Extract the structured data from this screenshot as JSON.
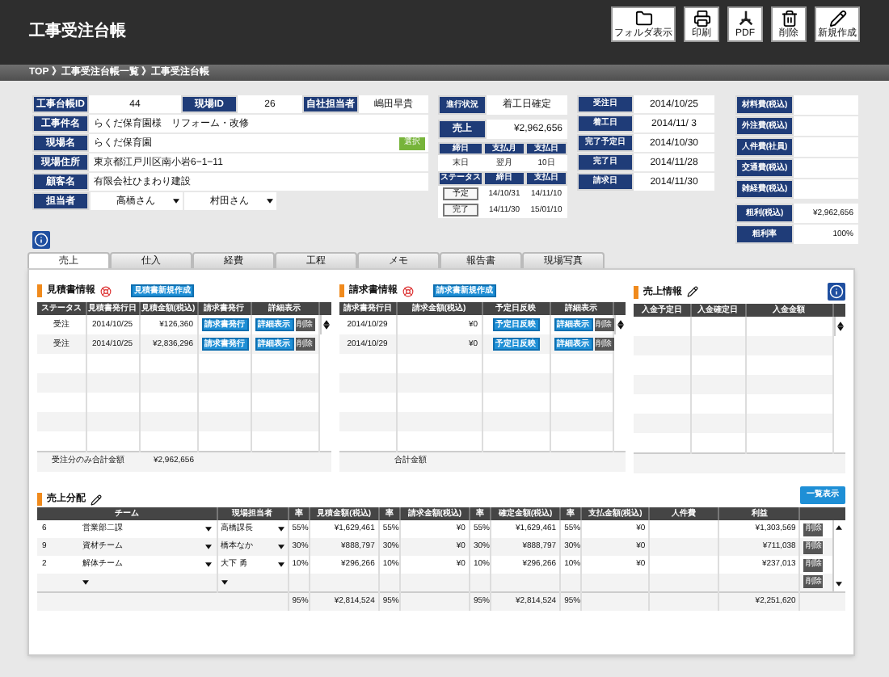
{
  "header": {
    "title": "工事受注台帳",
    "toolbar": [
      {
        "kind": "folder",
        "label": "フォルダ表示"
      },
      {
        "kind": "print",
        "label": "印刷"
      },
      {
        "kind": "pdf",
        "label": "PDF"
      },
      {
        "kind": "trash",
        "label": "削除"
      },
      {
        "kind": "pencil",
        "label": "新規作成"
      }
    ]
  },
  "breadcrumb": "TOP 》工事受注台帳一覧 》工事受注台帳",
  "project": {
    "ids": [
      {
        "label": "工事台帳ID",
        "value": "44"
      },
      {
        "label": "現場ID",
        "value": "26"
      },
      {
        "label": "自社担当者",
        "value": "嶋田早貴"
      }
    ],
    "rows": [
      {
        "label": "工事件名",
        "value": "らくだ保育園様　リフォーム・改修"
      },
      {
        "label": "現場名",
        "value": "らくだ保育園",
        "button": "選択"
      },
      {
        "label": "現場住所",
        "value": "東京都江戸川区南小岩6−1−11"
      },
      {
        "label": "顧客名",
        "value": "有限会社ひまわり建設"
      }
    ],
    "staff": {
      "label": "担当者",
      "selects": [
        "高橋さん",
        "村田さん"
      ]
    }
  },
  "status": {
    "progress": {
      "label": "進行状況",
      "value": "着工日確定"
    },
    "sales": {
      "label": "売上",
      "value": "¥2,962,656"
    },
    "closing": {
      "columns": [
        "締日",
        "支払月",
        "支払日"
      ],
      "values": [
        "末日",
        "翌月",
        "10日"
      ]
    },
    "schedule": {
      "columns": [
        "ステータス",
        "締日",
        "支払日"
      ],
      "rows": [
        {
          "status": "予定",
          "closing": "14/10/31",
          "payment": "14/11/10"
        },
        {
          "status": "完了",
          "closing": "14/11/30",
          "payment": "15/01/10"
        }
      ]
    }
  },
  "dates": [
    {
      "label": "受注日",
      "value": "2014/10/25"
    },
    {
      "label": "着工日",
      "value": "2014/11/ 3"
    },
    {
      "label": "完了予定日",
      "value": "2014/10/30"
    },
    {
      "label": "完了日",
      "value": "2014/11/28"
    },
    {
      "label": "請求日",
      "value": "2014/11/30"
    }
  ],
  "costs": [
    {
      "label": "材料費(税込)"
    },
    {
      "label": "外注費(税込)"
    },
    {
      "label": "人件費(社員)"
    },
    {
      "label": "交通費(税込)"
    },
    {
      "label": "雑経費(税込)"
    }
  ],
  "profit": [
    {
      "label": "粗利(税込)",
      "value": "¥2,962,656"
    },
    {
      "label": "粗利率",
      "value": "100%"
    }
  ],
  "tabs": [
    {
      "label": "売上",
      "selected": true
    },
    {
      "label": "仕入",
      "selected": false
    },
    {
      "label": "経費",
      "selected": false
    },
    {
      "label": "工程",
      "selected": false
    },
    {
      "label": "メモ",
      "selected": false
    },
    {
      "label": "報告書",
      "selected": false
    },
    {
      "label": "現場写真",
      "selected": false
    }
  ],
  "estimates": {
    "title": "見積書情報",
    "create_button": "見積書新規作成",
    "columns": [
      "ステータス",
      "見積書発行日",
      "見積金額(税込)",
      "請求書発行",
      "詳細表示"
    ],
    "rows": [
      {
        "status": "受注",
        "date": "2014/10/25",
        "amount": "¥126,360",
        "issue": "請求書発行",
        "detail": "詳細表示",
        "delete": "削除"
      },
      {
        "status": "受注",
        "date": "2014/10/25",
        "amount": "¥2,836,296",
        "issue": "請求書発行",
        "detail": "詳細表示",
        "delete": "削除"
      }
    ],
    "total_label": "受注分のみ合計金額",
    "total": "¥2,962,656"
  },
  "invoices": {
    "title": "請求書情報",
    "create_button": "請求書新規作成",
    "columns": [
      "請求書発行日",
      "請求金額(税込)",
      "予定日反映",
      "詳細表示"
    ],
    "rows": [
      {
        "date": "2014/10/29",
        "amount": "¥0",
        "reflect": "予定日反映",
        "detail": "詳細表示",
        "delete": "削除"
      },
      {
        "date": "2014/10/29",
        "amount": "¥0",
        "reflect": "予定日反映",
        "detail": "詳細表示",
        "delete": "削除"
      }
    ],
    "total_label": "合計金額"
  },
  "receipts": {
    "title": "売上情報",
    "columns": [
      "入金予定日",
      "入金確定日",
      "入金金額"
    ]
  },
  "distribution": {
    "title": "売上分配",
    "list_button": "一覧表示",
    "columns": [
      "チーム",
      "現場担当者",
      "率",
      "見積金額(税込)",
      "率",
      "請求金額(税込)",
      "率",
      "確定金額(税込)",
      "率",
      "支払金額(税込)",
      "人件費",
      "利益"
    ],
    "rows": [
      {
        "no": "6",
        "team": "営業部二課",
        "person": "高橋課長",
        "rate1": "55%",
        "estimate": "¥1,629,461",
        "rate2": "55%",
        "invoice": "¥0",
        "rate3": "55%",
        "confirmed": "¥1,629,461",
        "rate4": "55%",
        "payment": "¥0",
        "profit": "¥1,303,569",
        "delete": "削除"
      },
      {
        "no": "9",
        "team": "資材チーム",
        "person": "橋本なか",
        "rate1": "30%",
        "estimate": "¥888,797",
        "rate2": "30%",
        "invoice": "¥0",
        "rate3": "30%",
        "confirmed": "¥888,797",
        "rate4": "30%",
        "payment": "¥0",
        "profit": "¥711,038",
        "delete": "削除"
      },
      {
        "no": "2",
        "team": "解体チーム",
        "person": "大下 勇",
        "rate1": "10%",
        "estimate": "¥296,266",
        "rate2": "10%",
        "invoice": "¥0",
        "rate3": "10%",
        "confirmed": "¥296,266",
        "rate4": "10%",
        "payment": "¥0",
        "profit": "¥237,013",
        "delete": "削除"
      },
      {
        "delete": "削除"
      }
    ],
    "totals": {
      "rate1": "95%",
      "estimate": "¥2,814,524",
      "rate2": "95%",
      "rate3": "95%",
      "confirmed": "¥2,814,524",
      "rate4": "95%",
      "profit": "¥2,251,620"
    }
  }
}
